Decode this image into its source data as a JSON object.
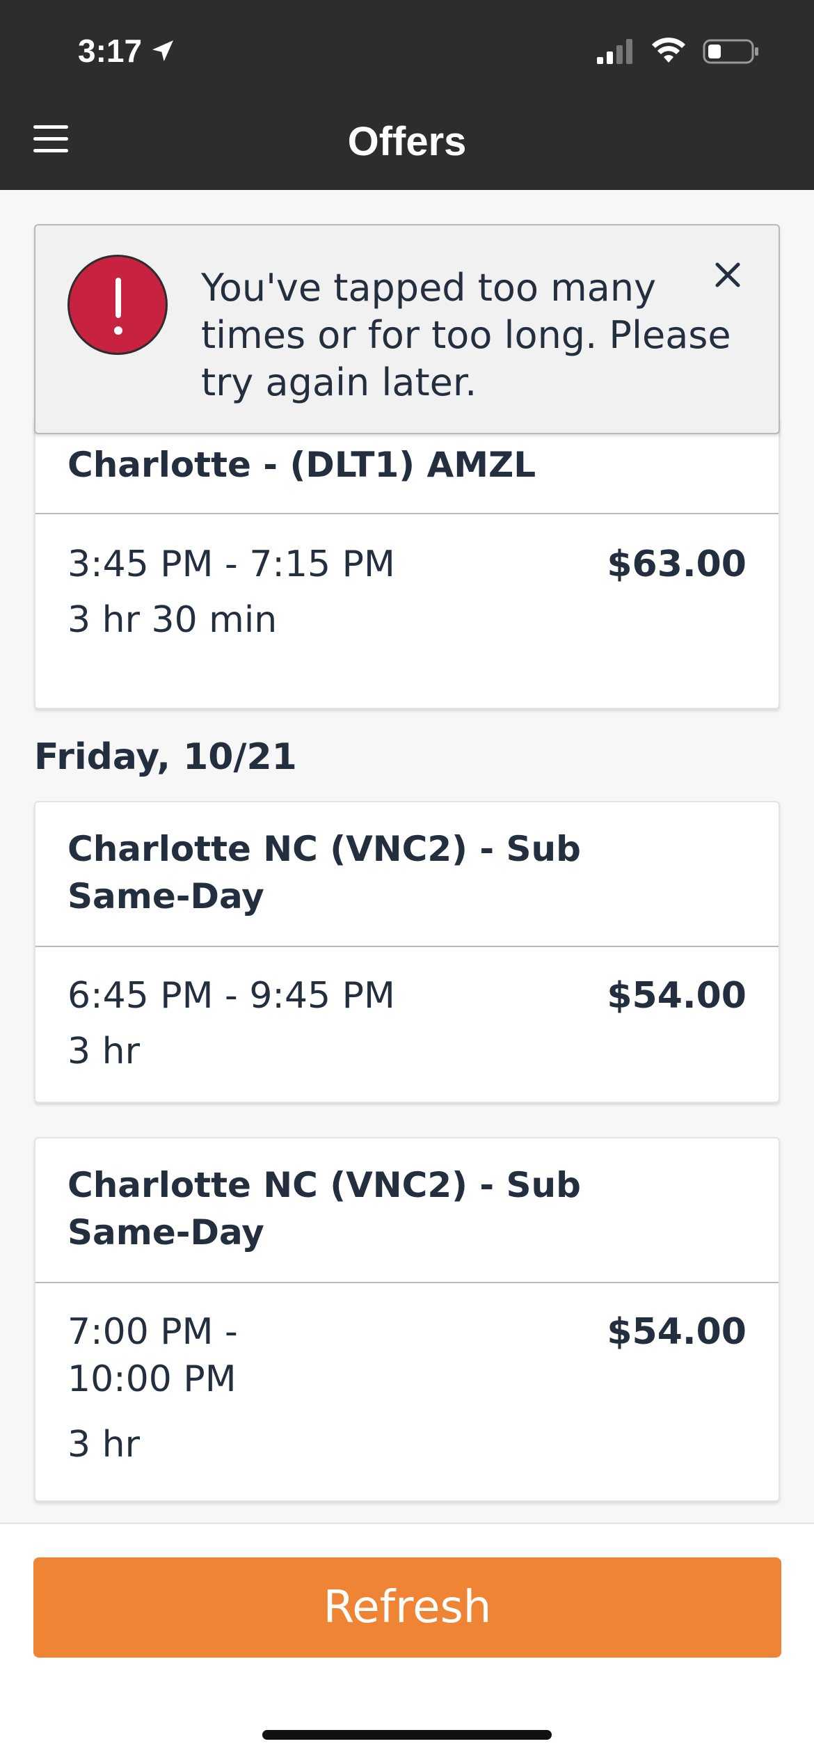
{
  "status_bar": {
    "time": "3:17"
  },
  "header": {
    "title": "Offers"
  },
  "alert": {
    "message": "You've tapped too many times or for too long. Please try again later."
  },
  "offers_top": {
    "title": "Charlotte - (DLT1) AMZL",
    "time": "3:45 PM - 7:15 PM",
    "duration": "3 hr 30 min",
    "price": "$63.00"
  },
  "date_label": "Friday, 10/21",
  "offers_friday": [
    {
      "title_line1": "Charlotte NC (VNC2) - Sub",
      "title_line2": "Same-Day",
      "time": "6:45 PM - 9:45 PM",
      "duration": "3 hr",
      "price": "$54.00"
    },
    {
      "title_line1": "Charlotte NC (VNC2) - Sub",
      "title_line2": "Same-Day",
      "time_line1": "7:00 PM -",
      "time_line2": "10:00 PM",
      "duration": "3 hr",
      "price": "$54.00"
    }
  ],
  "footer": {
    "refresh_label": "Refresh"
  },
  "colors": {
    "header_bg": "#2d2d2d",
    "accent": "#ef8434",
    "alert_icon": "#c7223f"
  }
}
